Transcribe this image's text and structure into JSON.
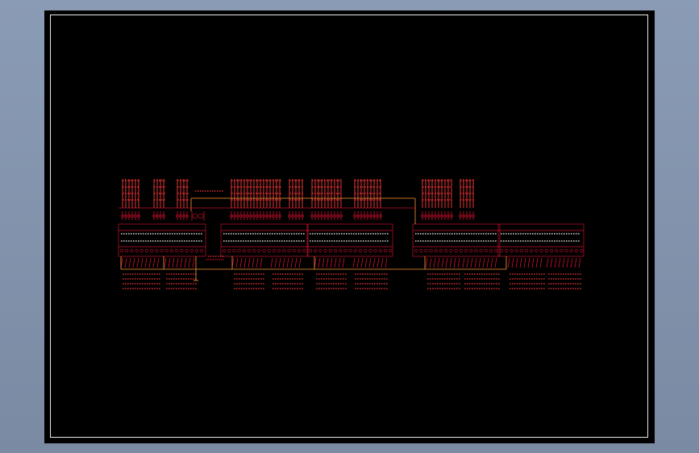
{
  "viewport": {
    "background_color": "#7f90aa"
  },
  "drawing": {
    "sheet_color": "#000000",
    "frame_color": "#e8e8e8",
    "wire_color": "#ff9933",
    "component_color": "#c8102e",
    "text_color": "#ff3a3a"
  }
}
